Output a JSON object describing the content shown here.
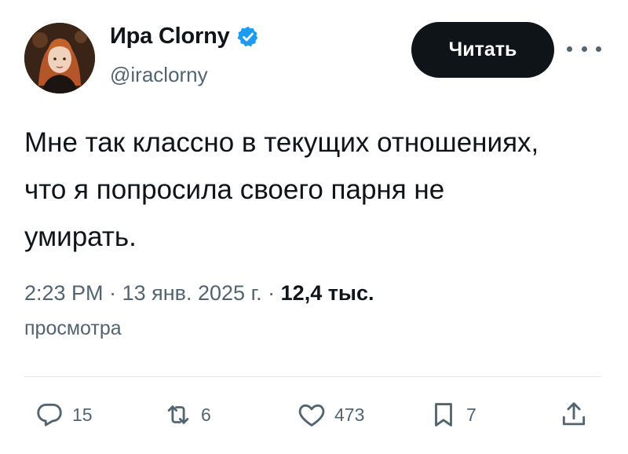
{
  "author": {
    "display_name": "Ира Clorny",
    "handle": "@iraclorny",
    "verified_icon": "verified-badge-icon",
    "accent_color": "#1d9bf0"
  },
  "follow_button": {
    "label": "Читать"
  },
  "tweet": {
    "lines": [
      "Мне так классно в текущих отношениях,",
      "что я попросила своего парня не",
      "умирать."
    ],
    "time": "2:23 PM",
    "date": "13 янв. 2025 г.",
    "separator": "·",
    "views_count": "12,4 тыс.",
    "views_label": "просмотра"
  },
  "actions": {
    "replies": {
      "icon": "reply-icon",
      "count": "15"
    },
    "reposts": {
      "icon": "repost-icon",
      "count": "6"
    },
    "likes": {
      "icon": "heart-icon",
      "count": "473"
    },
    "bookmarks": {
      "icon": "bookmark-icon",
      "count": "7"
    },
    "share": {
      "icon": "share-icon"
    }
  }
}
